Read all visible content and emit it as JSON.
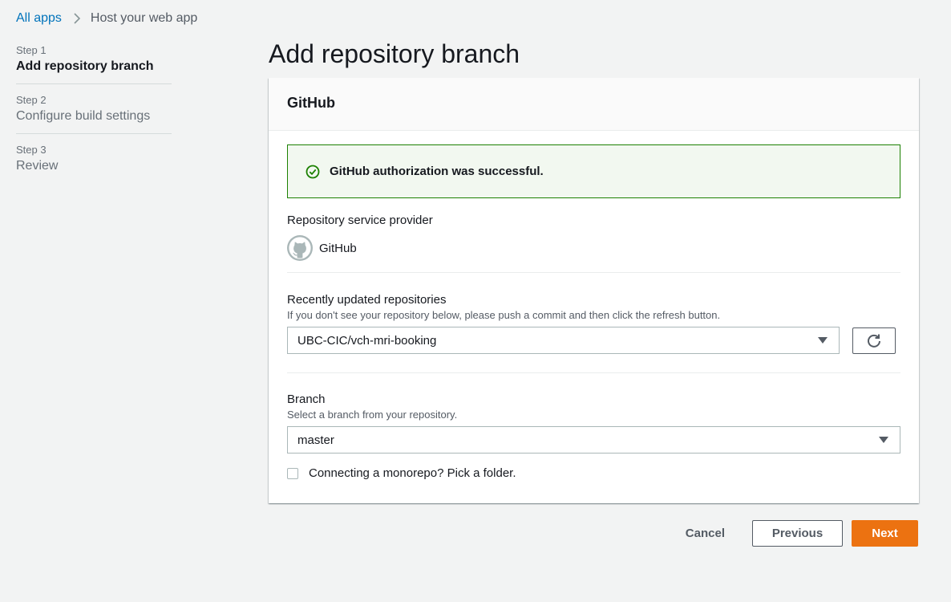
{
  "breadcrumb": {
    "root": "All apps",
    "current": "Host your web app"
  },
  "steps": [
    {
      "num": "Step 1",
      "title": "Add repository branch",
      "active": true
    },
    {
      "num": "Step 2",
      "title": "Configure build settings",
      "active": false
    },
    {
      "num": "Step 3",
      "title": "Review",
      "active": false
    }
  ],
  "page": {
    "title": "Add repository branch"
  },
  "panel": {
    "header": "GitHub",
    "alert": "GitHub authorization was successful.",
    "provider_label": "Repository service provider",
    "provider_name": "GitHub",
    "repos_label": "Recently updated repositories",
    "repos_desc": "If you don't see your repository below, please push a commit and then click the refresh button.",
    "repo_selected": "UBC-CIC/vch-mri-booking",
    "branch_label": "Branch",
    "branch_desc": "Select a branch from your repository.",
    "branch_selected": "master",
    "monorepo_label": "Connecting a monorepo? Pick a folder."
  },
  "actions": {
    "cancel": "Cancel",
    "previous": "Previous",
    "next": "Next"
  },
  "colors": {
    "link": "#0073bb",
    "success": "#1d8102",
    "primary": "#ec7211"
  },
  "icons": [
    "chevron-right-icon",
    "check-circle-icon",
    "github-icon",
    "caret-down-icon",
    "refresh-icon"
  ]
}
